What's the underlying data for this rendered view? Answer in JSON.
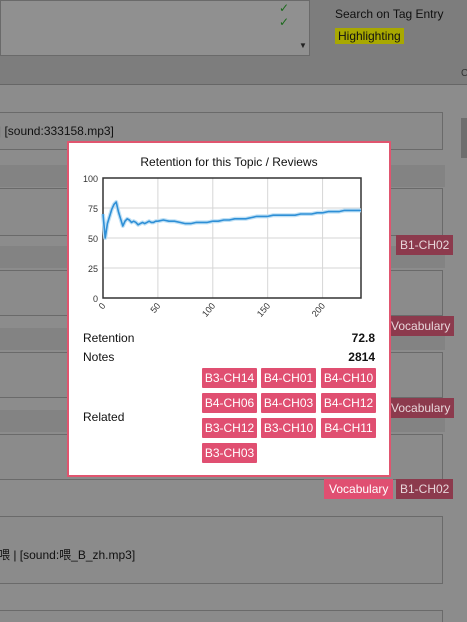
{
  "background": {
    "search_label": "Search on Tag Entry",
    "highlight_label": "Highlighting",
    "edge_letter": "C",
    "row1_text": "| [sound:333158.mp3]",
    "row2_text": "喂 | [sound:喂_B_zh.mp3]",
    "tags": {
      "b1_ch02_a": "B1-CH02",
      "vocab_a": "Vocabulary",
      "vocab_b": "Vocabulary",
      "vocab_c": "Vocabulary",
      "b1_ch02_b": "B1-CH02"
    }
  },
  "popup": {
    "retention_label": "Retention",
    "retention_value": "72.8",
    "notes_label": "Notes",
    "notes_value": "2814",
    "related_label": "Related",
    "related_tags": [
      "B3-CH14",
      "B4-CH01",
      "B4-CH10",
      "B4-CH06",
      "B4-CH03",
      "B4-CH12",
      "B3-CH12",
      "B3-CH10",
      "B4-CH11",
      "B3-CH03"
    ]
  },
  "chart_data": {
    "type": "line",
    "title": "Retention for this Topic / Reviews",
    "xlabel": "",
    "ylabel": "",
    "xlim": [
      0,
      235
    ],
    "ylim": [
      0,
      100
    ],
    "x_ticks": [
      "0",
      "50",
      "100",
      "150",
      "200"
    ],
    "y_ticks": [
      "0",
      "25",
      "50",
      "75",
      "100"
    ],
    "grid": true,
    "color": "#2e8fd6",
    "series": [
      {
        "x": [
          0,
          2,
          4,
          6,
          8,
          10,
          12,
          14,
          16,
          18,
          20,
          22,
          24,
          26,
          28,
          30,
          32,
          34,
          36,
          38,
          40,
          42,
          44,
          46,
          48,
          50,
          55,
          60,
          65,
          70,
          75,
          80,
          85,
          90,
          95,
          100,
          105,
          110,
          115,
          120,
          125,
          130,
          135,
          140,
          145,
          150,
          155,
          160,
          165,
          170,
          175,
          180,
          185,
          190,
          195,
          200,
          205,
          210,
          215,
          220,
          225,
          230,
          235
        ],
        "y": [
          70,
          50,
          62,
          68,
          74,
          78,
          80,
          72,
          66,
          60,
          64,
          66,
          65,
          63,
          64,
          63,
          61,
          62,
          63,
          62,
          63,
          64,
          63,
          63,
          64,
          64,
          65,
          64,
          64,
          63,
          62,
          62,
          63,
          63,
          63,
          64,
          64,
          65,
          65,
          66,
          66,
          66,
          67,
          68,
          68,
          68,
          69,
          69,
          69,
          69,
          69,
          70,
          70,
          70,
          71,
          71,
          72,
          72,
          72,
          73,
          73,
          73,
          73
        ]
      }
    ]
  }
}
